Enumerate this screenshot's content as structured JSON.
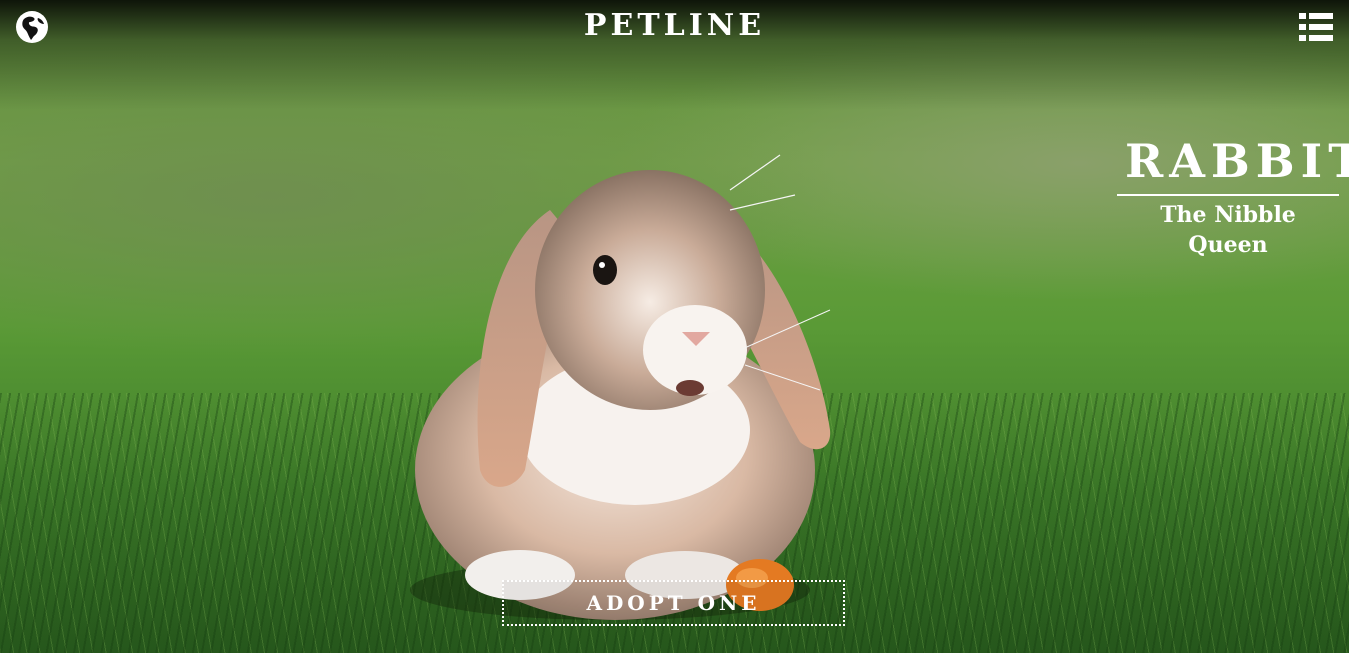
{
  "header": {
    "brand": "PETLINE",
    "globe_icon": "globe-icon",
    "menu_icon": "list-menu-icon"
  },
  "hero": {
    "image_subject": "rabbit-photo",
    "title": "RABBIT",
    "subtitle": "The Nibble Queen",
    "cta_label": "ADOPT ONE"
  },
  "colors": {
    "text": "#ffffff",
    "grass_light": "#6fa044",
    "grass_dark": "#2f6a22"
  }
}
